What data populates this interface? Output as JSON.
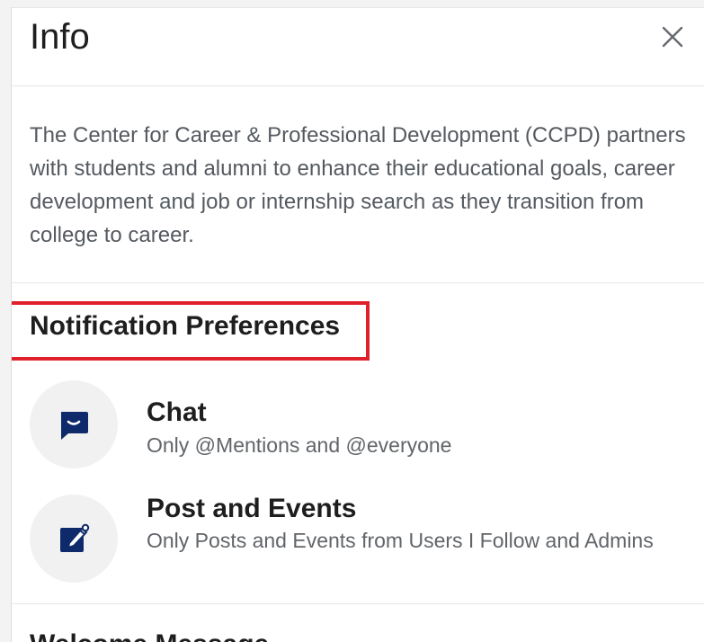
{
  "panel": {
    "title": "Info",
    "close_icon": "close-icon"
  },
  "about": {
    "text": "The Center for Career & Professional Development (CCPD) partners with students and alumni to enhance their educational goals, career development and job or internship search as they transition from college to career."
  },
  "notification_preferences": {
    "title": "Notification Preferences",
    "items": [
      {
        "name": "Chat",
        "description": "Only @Mentions and @everyone",
        "icon": "chat-bubble-icon"
      },
      {
        "name": "Post and Events",
        "description": "Only Posts and Events from Users I Follow and Admins",
        "icon": "edit-note-icon"
      }
    ]
  },
  "next_section": {
    "title": "Welcome Message"
  },
  "colors": {
    "accent": "#0e2a6b",
    "highlight": "#e0202a",
    "icon_bg": "#f1f1f2",
    "body_text": "#555a60"
  }
}
